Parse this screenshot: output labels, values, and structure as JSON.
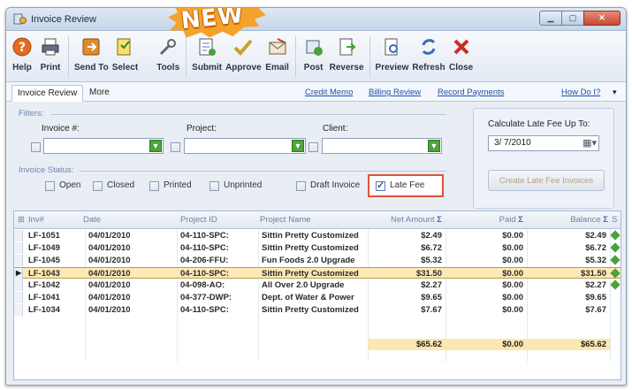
{
  "window": {
    "title": "Invoice Review"
  },
  "badge": {
    "text": "NEW"
  },
  "toolbar": {
    "items": [
      {
        "label": "Help"
      },
      {
        "label": "Print"
      },
      {
        "label": "Send To"
      },
      {
        "label": "Select"
      },
      {
        "label": "Tools"
      },
      {
        "label": "Submit"
      },
      {
        "label": "Approve"
      },
      {
        "label": "Email"
      },
      {
        "label": "Post"
      },
      {
        "label": "Reverse"
      },
      {
        "label": "Preview"
      },
      {
        "label": "Refresh"
      },
      {
        "label": "Close"
      }
    ]
  },
  "tabs": {
    "active": "Invoice Review",
    "more": "More"
  },
  "links": {
    "credit_memo": "Credit Memo",
    "billing_review": "Billing Review",
    "record_payments": "Record Payments",
    "how_do_i": "How Do I?"
  },
  "filters": {
    "group_label": "Filters:",
    "invoice_label": "Invoice #:",
    "project_label": "Project:",
    "client_label": "Client:"
  },
  "status": {
    "group_label": "Invoice Status:",
    "items": [
      "Open",
      "Closed",
      "Printed",
      "Unprinted",
      "Draft Invoice",
      "Late Fee"
    ]
  },
  "calc": {
    "label": "Calculate Late Fee Up To:",
    "date": "3/ 7/2010",
    "button": "Create Late Fee Invoices"
  },
  "grid": {
    "columns": [
      "Inv#",
      "Date",
      "Project ID",
      "Project Name",
      "Net Amount",
      "Paid",
      "Balance",
      "S"
    ],
    "rows": [
      [
        "LF-1051",
        "04/01/2010",
        "04-110-SPC:",
        "Sittin Pretty Customized",
        "$2.49",
        "$0.00",
        "$2.49"
      ],
      [
        "LF-1049",
        "04/01/2010",
        "04-110-SPC:",
        "Sittin Pretty Customized",
        "$6.72",
        "$0.00",
        "$6.72"
      ],
      [
        "LF-1045",
        "04/01/2010",
        "04-206-FFU:",
        "Fun Foods 2.0 Upgrade",
        "$5.32",
        "$0.00",
        "$5.32"
      ],
      [
        "LF-1043",
        "04/01/2010",
        "04-110-SPC:",
        "Sittin Pretty Customized",
        "$31.50",
        "$0.00",
        "$31.50"
      ],
      [
        "LF-1042",
        "04/01/2010",
        "04-098-AO:",
        "All Over 2.0 Upgrade",
        "$2.27",
        "$0.00",
        "$2.27"
      ],
      [
        "LF-1041",
        "04/01/2010",
        "04-377-DWP:",
        "Dept. of Water & Power",
        "$9.65",
        "$0.00",
        "$9.65"
      ],
      [
        "LF-1034",
        "04/01/2010",
        "04-110-SPC:",
        "Sittin Pretty Customized",
        "$7.67",
        "$0.00",
        "$7.67"
      ]
    ],
    "totals": {
      "net": "$65.62",
      "paid": "$0.00",
      "balance": "$65.62"
    }
  }
}
